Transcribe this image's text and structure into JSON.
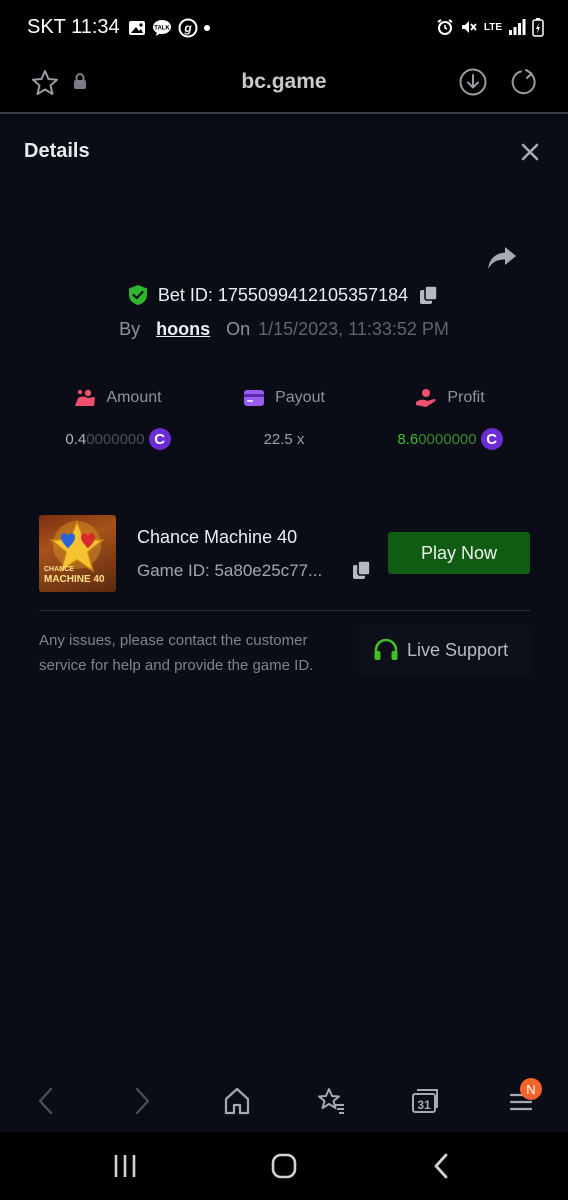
{
  "status_bar": {
    "carrier_time": "SKT 11:34",
    "network": "LTE"
  },
  "browser": {
    "url": "bc.game"
  },
  "sheet": {
    "title": "Details",
    "bet_label": "Bet ID: 1755099412105357184",
    "by_label": "By",
    "username": "hoons",
    "on_label": "On",
    "datetime": "1/15/2023, 11:33:52 PM",
    "stats": {
      "amount": {
        "label": "Amount",
        "value_main": "0.4",
        "value_faint": "0000000",
        "coin": "C"
      },
      "payout": {
        "label": "Payout",
        "value": "22.5 x"
      },
      "profit": {
        "label": "Profit",
        "value_main": "8.6",
        "value_faint": "0000000",
        "coin": "C",
        "color": "#3fbf2a"
      }
    },
    "game": {
      "name": "Chance Machine 40",
      "id_label": "Game ID: 5a80e25c77...",
      "thumb_text_1": "CHANCE",
      "thumb_text_2": "MACHINE 40",
      "play_label": "Play Now"
    },
    "help_text": "Any issues, please contact the customer service for help and provide the game ID.",
    "support_label": "Live Support"
  },
  "nav": {
    "tabs_count": "31",
    "menu_badge": "N"
  },
  "colors": {
    "accent_green": "#0f5c12",
    "profit_green": "#3fbf2a",
    "coin_purple": "#6d2cd6",
    "badge_orange": "#f5632a"
  }
}
